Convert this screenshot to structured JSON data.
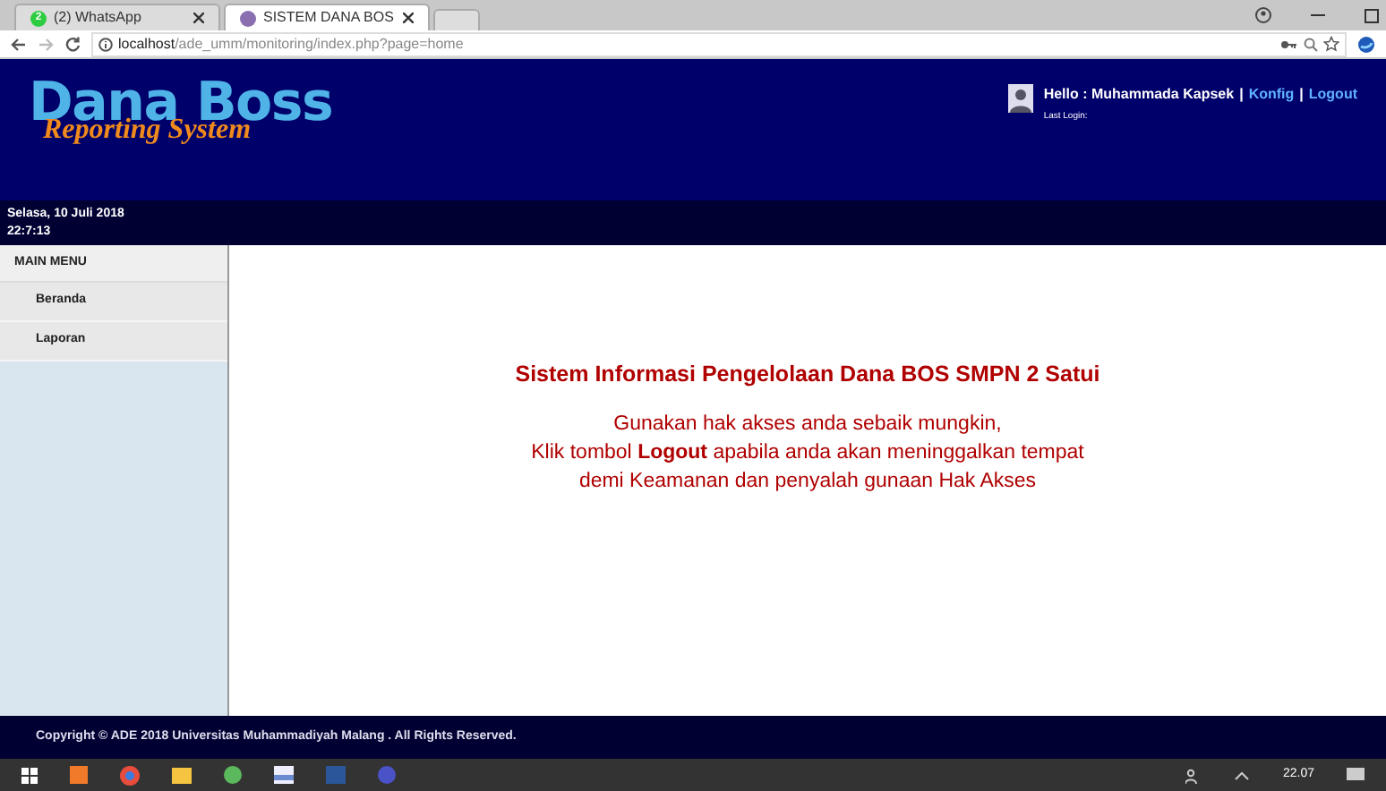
{
  "browser": {
    "tabs": [
      {
        "label": "(2) WhatsApp",
        "badge": "2",
        "selected": false
      },
      {
        "label": "SISTEM DANA BOS",
        "selected": true
      }
    ],
    "address": {
      "host": "localhost",
      "path": "/ade_umm/monitoring/index.php?page=home"
    }
  },
  "header": {
    "logo_title": "Dana Boss",
    "logo_subtitle": "Reporting System",
    "greeting": "Hello : Muhammada Kapsek",
    "links": [
      {
        "separator": "|",
        "label": "Konfig"
      },
      {
        "separator": "|",
        "label": "Logout"
      }
    ],
    "last_login": "Last Login:",
    "date": "Selasa, 10 Juli 2018",
    "time": "22:7:13"
  },
  "sidebar": {
    "title": "MAIN MENU",
    "items": [
      {
        "label": "Beranda"
      },
      {
        "label": "Laporan"
      }
    ]
  },
  "main": {
    "heading": "Sistem Informasi Pengelolaan Dana BOS SMPN 2 Satui",
    "lines": [
      "Gunakan hak akses anda sebaik mungkin,",
      "Klik tombol **Logout** apabila anda akan meninggalkan tempat",
      "demi Keamanan dan penyalah gunaan Hak Akses"
    ]
  },
  "footer": "Copyright © ADE 2018 Universitas Muhammadiyah Malang . All Rights Reserved.",
  "taskbar": {
    "clock": "22.07"
  }
}
